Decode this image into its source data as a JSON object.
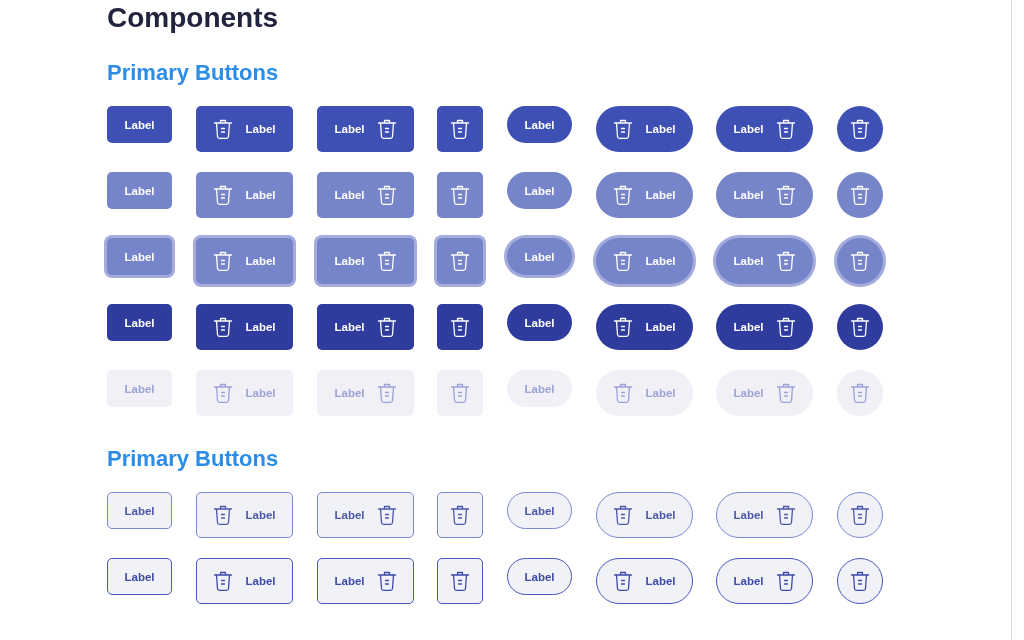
{
  "page": {
    "title": "Components"
  },
  "sections": [
    {
      "heading": "Primary Buttons",
      "kind": "filled",
      "rows": [
        {
          "kind": "default",
          "buttons": [
            {
              "kind": "text-rect",
              "label": "Label"
            },
            {
              "kind": "icon-left-rect",
              "label": "Label"
            },
            {
              "kind": "icon-right-rect",
              "label": "Label"
            },
            {
              "kind": "icon-rect"
            },
            {
              "kind": "text-pill",
              "label": "Label"
            },
            {
              "kind": "icon-left-pill",
              "label": "Label"
            },
            {
              "kind": "icon-right-pill",
              "label": "Label"
            },
            {
              "kind": "icon-round"
            }
          ]
        },
        {
          "kind": "hover",
          "buttons": [
            {
              "kind": "text-rect",
              "label": "Label"
            },
            {
              "kind": "icon-left-rect",
              "label": "Label"
            },
            {
              "kind": "icon-right-rect",
              "label": "Label"
            },
            {
              "kind": "icon-rect"
            },
            {
              "kind": "text-pill",
              "label": "Label"
            },
            {
              "kind": "icon-left-pill",
              "label": "Label"
            },
            {
              "kind": "icon-right-pill",
              "label": "Label"
            },
            {
              "kind": "icon-round"
            }
          ]
        },
        {
          "kind": "focus",
          "buttons": [
            {
              "kind": "text-rect",
              "label": "Label"
            },
            {
              "kind": "icon-left-rect",
              "label": "Label"
            },
            {
              "kind": "icon-right-rect",
              "label": "Label"
            },
            {
              "kind": "icon-rect"
            },
            {
              "kind": "text-pill",
              "label": "Label"
            },
            {
              "kind": "icon-left-pill",
              "label": "Label"
            },
            {
              "kind": "icon-right-pill",
              "label": "Label"
            },
            {
              "kind": "icon-round"
            }
          ]
        },
        {
          "kind": "pressed",
          "buttons": [
            {
              "kind": "text-rect",
              "label": "Label"
            },
            {
              "kind": "icon-left-rect",
              "label": "Label"
            },
            {
              "kind": "icon-right-rect",
              "label": "Label"
            },
            {
              "kind": "icon-rect"
            },
            {
              "kind": "text-pill",
              "label": "Label"
            },
            {
              "kind": "icon-left-pill",
              "label": "Label"
            },
            {
              "kind": "icon-right-pill",
              "label": "Label"
            },
            {
              "kind": "icon-round"
            }
          ]
        },
        {
          "kind": "disabled",
          "buttons": [
            {
              "kind": "text-rect",
              "label": "Label"
            },
            {
              "kind": "icon-left-rect",
              "label": "Label"
            },
            {
              "kind": "icon-right-rect",
              "label": "Label"
            },
            {
              "kind": "icon-rect"
            },
            {
              "kind": "text-pill",
              "label": "Label"
            },
            {
              "kind": "icon-left-pill",
              "label": "Label"
            },
            {
              "kind": "icon-right-pill",
              "label": "Label"
            },
            {
              "kind": "icon-round"
            }
          ]
        }
      ]
    },
    {
      "heading": "Primary Buttons",
      "kind": "outline",
      "rows": [
        {
          "kind": "default",
          "buttons": [
            {
              "kind": "text-rect",
              "label": "Label"
            },
            {
              "kind": "icon-left-rect",
              "label": "Label"
            },
            {
              "kind": "icon-right-rect",
              "label": "Label"
            },
            {
              "kind": "icon-rect"
            },
            {
              "kind": "text-pill",
              "label": "Label"
            },
            {
              "kind": "icon-left-pill",
              "label": "Label"
            },
            {
              "kind": "icon-right-pill",
              "label": "Label"
            },
            {
              "kind": "icon-round"
            }
          ]
        },
        {
          "kind": "hover",
          "buttons": [
            {
              "kind": "text-rect",
              "label": "Label"
            },
            {
              "kind": "icon-left-rect",
              "label": "Label"
            },
            {
              "kind": "icon-right-rect",
              "label": "Label"
            },
            {
              "kind": "icon-rect"
            },
            {
              "kind": "text-pill",
              "label": "Label"
            },
            {
              "kind": "icon-left-pill",
              "label": "Label"
            },
            {
              "kind": "icon-right-pill",
              "label": "Label"
            },
            {
              "kind": "icon-round"
            }
          ]
        }
      ]
    }
  ]
}
